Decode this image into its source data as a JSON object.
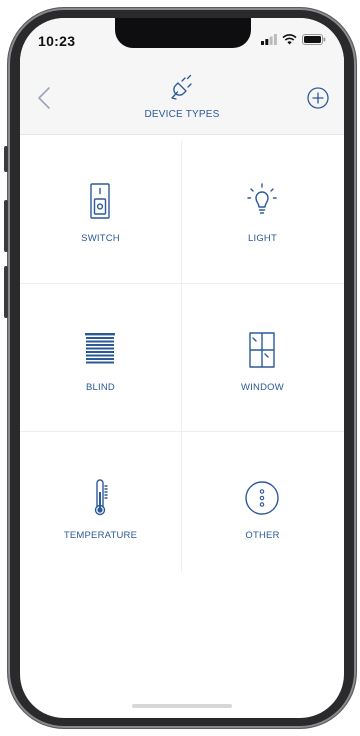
{
  "status_bar": {
    "time": "10:23"
  },
  "header": {
    "title": "DEVICE TYPES",
    "icon": "plug-icon",
    "back_icon": "chevron-left-icon",
    "add_icon": "plus-circle-icon"
  },
  "device_types": [
    {
      "label": "SWITCH",
      "icon": "switch-icon"
    },
    {
      "label": "LIGHT",
      "icon": "lightbulb-icon"
    },
    {
      "label": "BLIND",
      "icon": "blind-icon"
    },
    {
      "label": "WINDOW",
      "icon": "window-icon"
    },
    {
      "label": "TEMPERATURE",
      "icon": "thermometer-icon"
    },
    {
      "label": "OTHER",
      "icon": "more-icon"
    }
  ],
  "colors": {
    "accent": "#2c5a96",
    "header_bg": "#f6f6f7",
    "divider": "#eceef1"
  }
}
